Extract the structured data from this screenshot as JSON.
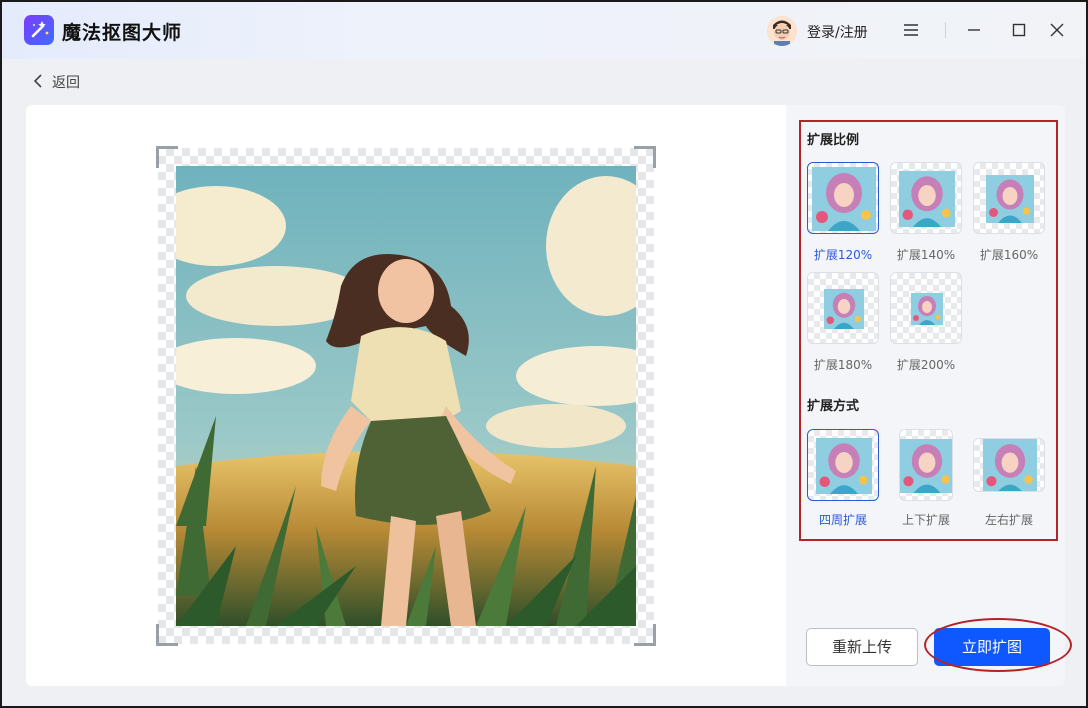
{
  "app": {
    "title": "魔法抠图大师",
    "logo_icon": "magic-wand-icon"
  },
  "header": {
    "login_label": "登录/注册",
    "icons": [
      "menu-icon",
      "minimize-icon",
      "maximize-icon",
      "close-icon"
    ]
  },
  "nav": {
    "back_label": "返回"
  },
  "panel": {
    "ratio_title": "扩展比例",
    "ratios": [
      {
        "label": "扩展120%",
        "selected": true
      },
      {
        "label": "扩展140%",
        "selected": false
      },
      {
        "label": "扩展160%",
        "selected": false
      },
      {
        "label": "扩展180%",
        "selected": false
      },
      {
        "label": "扩展200%",
        "selected": false
      }
    ],
    "mode_title": "扩展方式",
    "modes": [
      {
        "label": "四周扩展",
        "selected": true
      },
      {
        "label": "上下扩展",
        "selected": false
      },
      {
        "label": "左右扩展",
        "selected": false
      }
    ]
  },
  "actions": {
    "reupload_label": "重新上传",
    "expand_label": "立即扩图"
  },
  "colors": {
    "accent": "#0f57ff",
    "selected": "#2a5bd7",
    "annotation": "#b4232a"
  }
}
